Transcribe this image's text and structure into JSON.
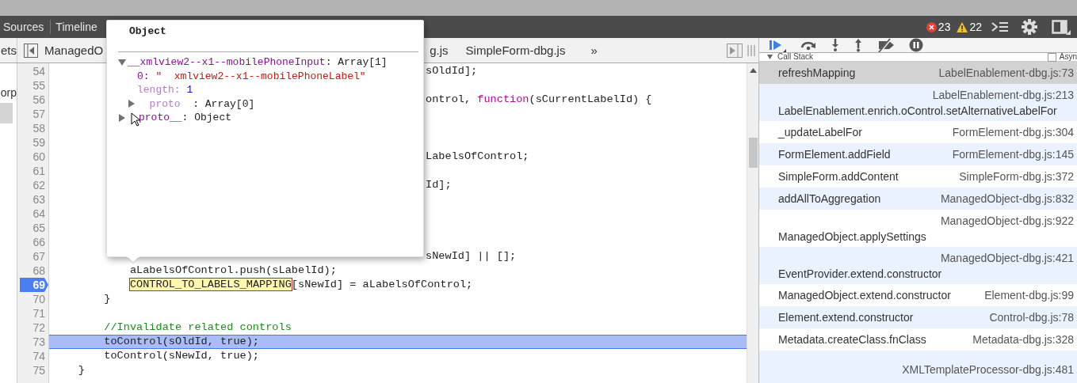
{
  "top_toolbar": {
    "tabs": [
      {
        "label": "Sources"
      },
      {
        "label": "Timeline"
      }
    ],
    "error_count": "23",
    "warning_count": "22"
  },
  "file_tabs": {
    "panel_tab": "ets",
    "tabs": [
      {
        "label": "ManagedO"
      },
      {
        "label": "g.js"
      },
      {
        "label": "SimpleForm-dbg.js"
      }
    ],
    "overflow": "»"
  },
  "navigator": {
    "items": [
      {
        "label": "orp",
        "selected": false
      },
      {
        "selected": true
      }
    ]
  },
  "editor": {
    "lines": [
      {
        "number": "54",
        "kind": "behind_popup",
        "breakpoint": false,
        "current": false,
        "segments": [
          {
            "kind": "plain",
            "text": "sOldId];"
          }
        ]
      },
      {
        "number": "55",
        "kind": "behind_popup",
        "breakpoint": false,
        "current": false
      },
      {
        "number": "56",
        "kind": "behind_popup",
        "breakpoint": false,
        "current": false,
        "segments": [
          {
            "kind": "plain",
            "text": "ontrol, "
          },
          {
            "kind": "keyword",
            "text": "function"
          },
          {
            "kind": "plain",
            "text": "(sCurrentLabelId) {"
          }
        ]
      },
      {
        "number": "57",
        "kind": "behind_popup",
        "breakpoint": false,
        "current": false
      },
      {
        "number": "58",
        "kind": "behind_popup",
        "breakpoint": false,
        "current": false
      },
      {
        "number": "59",
        "kind": "behind_popup",
        "breakpoint": false,
        "current": false
      },
      {
        "number": "60",
        "kind": "behind_popup",
        "breakpoint": false,
        "current": false,
        "segments": [
          {
            "kind": "plain",
            "text": "LabelsOfControl;"
          }
        ]
      },
      {
        "number": "61",
        "kind": "behind_popup",
        "breakpoint": false,
        "current": false
      },
      {
        "number": "62",
        "kind": "behind_popup",
        "breakpoint": false,
        "current": false,
        "segments": [
          {
            "kind": "plain",
            "text": "Id];"
          }
        ]
      },
      {
        "number": "63",
        "kind": "behind_popup",
        "breakpoint": false,
        "current": false
      },
      {
        "number": "64",
        "kind": "behind_popup",
        "breakpoint": false,
        "current": false
      },
      {
        "number": "65",
        "kind": "behind_popup",
        "breakpoint": false,
        "current": false
      },
      {
        "number": "66",
        "kind": "behind_popup",
        "breakpoint": false,
        "current": false
      },
      {
        "number": "67",
        "kind": "behind_popup",
        "breakpoint": false,
        "current": false,
        "segments": [
          {
            "kind": "plain",
            "text": "sNewId] || [];"
          }
        ]
      },
      {
        "number": "68",
        "kind": "innermost",
        "breakpoint": false,
        "current": false,
        "segments": [
          {
            "kind": "plain",
            "text": "aLabelsOfControl.push(sLabelId);"
          }
        ]
      },
      {
        "number": "69",
        "kind": "innermost",
        "breakpoint": true,
        "current": false,
        "segments": [
          {
            "kind": "match",
            "text": "CONTROL_TO_LABELS_MAPPING"
          },
          {
            "kind": "plain",
            "text": "[sNewId] = aLabelsOfControl;"
          }
        ]
      },
      {
        "number": "70",
        "kind": "inner",
        "breakpoint": false,
        "current": false,
        "segments": [
          {
            "kind": "plain",
            "text": "}"
          }
        ]
      },
      {
        "number": "71",
        "kind": "blank",
        "breakpoint": false,
        "current": false
      },
      {
        "number": "72",
        "kind": "inner",
        "breakpoint": false,
        "current": false,
        "segments": [
          {
            "kind": "comment",
            "text": "//Invalidate related controls"
          }
        ]
      },
      {
        "number": "73",
        "kind": "inner",
        "breakpoint": false,
        "current": true,
        "segments": [
          {
            "kind": "plain",
            "text": "toControl(sOldId, true);"
          }
        ]
      },
      {
        "number": "74",
        "kind": "inner",
        "breakpoint": false,
        "current": false,
        "segments": [
          {
            "kind": "plain",
            "text": "toControl(sNewId, true);"
          }
        ]
      },
      {
        "number": "75",
        "kind": "outer",
        "breakpoint": false,
        "current": false,
        "segments": [
          {
            "kind": "plain",
            "text": "}"
          }
        ]
      }
    ]
  },
  "popover": {
    "title": "Object",
    "tree": [
      {
        "kind": "object",
        "key": "__xmlview2--x1--mobilePhoneInput",
        "value": ": Array[1]",
        "expanded": true,
        "children": [
          {
            "kind": "string",
            "key": "0:",
            "value": " \"  xmlview2--x1--mobilePhoneLabel\""
          },
          {
            "kind": "number",
            "key": "length:",
            "value": " 1"
          },
          {
            "kind": "object",
            "key": "  proto  ",
            "value": ": Array[0]",
            "expanded": false
          }
        ]
      },
      {
        "kind": "object",
        "key": "proto__",
        "value": ": Object",
        "expanded": false
      }
    ]
  },
  "call_stack": {
    "title": "Call Stack",
    "expanded": true,
    "async_label": "Asyn",
    "async_checked": false,
    "frames": [
      {
        "kind": "single",
        "function": "refreshMapping",
        "location": "LabelEnablement-dbg.js:73",
        "selected": true
      },
      {
        "kind": "double",
        "function": "LabelEnablement.enrich.oControl.setAlternativeLabelFor",
        "location": "LabelEnablement-dbg.js:213",
        "selected": false
      },
      {
        "kind": "single",
        "function": "_updateLabelFor",
        "location": "FormElement-dbg.js:304",
        "selected": false
      },
      {
        "kind": "single",
        "function": "FormElement.addField",
        "location": "FormElement-dbg.js:145",
        "selected": false
      },
      {
        "kind": "single",
        "function": "SimpleForm.addContent",
        "location": "SimpleForm-dbg.js:372",
        "selected": false
      },
      {
        "kind": "single",
        "function": "addAllToAggregation",
        "location": "ManagedObject-dbg.js:832",
        "selected": false
      },
      {
        "kind": "double",
        "function": "ManagedObject.applySettings",
        "location": "ManagedObject-dbg.js:922",
        "selected": false
      },
      {
        "kind": "double",
        "function": "EventProvider.extend.constructor",
        "location": "ManagedObject-dbg.js:421",
        "selected": false
      },
      {
        "kind": "single",
        "function": "ManagedObject.extend.constructor",
        "location": "Element-dbg.js:99",
        "selected": false
      },
      {
        "kind": "single",
        "function": "Element.extend.constructor",
        "location": "Control-dbg.js:78",
        "selected": false
      },
      {
        "kind": "single",
        "function": "Metadata.createClass.fnClass",
        "location": "Metadata-dbg.js:328",
        "selected": false
      },
      {
        "kind": "double",
        "location": "XMLTemplateProcessor-dbg.js:481",
        "selected": false
      }
    ]
  }
}
